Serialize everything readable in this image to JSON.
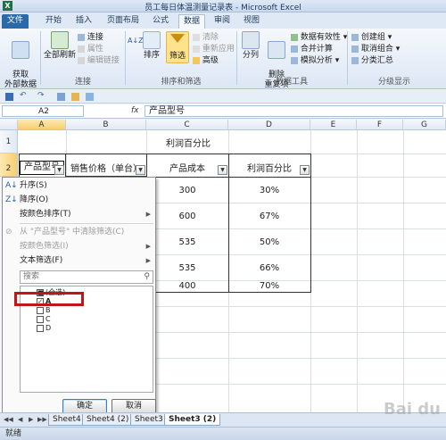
{
  "window": {
    "title": "员工每日体温测量记录表 - Microsoft Excel",
    "app_icon": "X"
  },
  "ribbon_tabs": [
    "文件",
    "开始",
    "插入",
    "页面布局",
    "公式",
    "数据",
    "审阅",
    "视图"
  ],
  "ribbon": {
    "get_external": "获取\n外部数据",
    "refresh_all": "全部刷新",
    "connections": "连接",
    "properties": "属性",
    "edit_links": "编辑链接",
    "sort_asc": "A↓Z",
    "sort": "排序",
    "filter": "筛选",
    "clear": "清除",
    "reapply": "重新应用",
    "advanced": "高级",
    "text_to_columns": "分列",
    "remove_dupes": "删除\n重复项",
    "data_validation": "数据有效性",
    "consolidate": "合并计算",
    "what_if": "模拟分析",
    "group": "创建组",
    "ungroup": "取消组合",
    "subtotal": "分类汇总",
    "group_connections": "连接",
    "group_sort_filter": "排序和筛选",
    "group_data_tools": "数据工具",
    "group_outline": "分级显示"
  },
  "formula_bar": {
    "name_box": "A2",
    "fx": "fx",
    "content": "产品型号"
  },
  "columns": [
    "A",
    "B",
    "C",
    "D",
    "E",
    "F",
    "G"
  ],
  "rows": [
    "1",
    "2"
  ],
  "sheet": {
    "title": "利润百分比",
    "headers": [
      "产品型号",
      "销售价格（单台）",
      "产品成本",
      "利润百分比"
    ],
    "cost": [
      "300",
      "600",
      "535",
      "535",
      "400"
    ],
    "profit": [
      "30%",
      "67%",
      "50%",
      "66%",
      "70%"
    ]
  },
  "dropdown_menu": {
    "sort_asc": "升序(S)",
    "sort_desc": "降序(O)",
    "sort_by_color": "按颜色排序(T)",
    "clear_filter": "从 \"产品型号\" 中清除筛选(C)",
    "filter_by_color": "按颜色筛选(I)",
    "text_filter": "文本筛选(F)",
    "search_placeholder": "搜索",
    "list": [
      "(全选)",
      "A",
      "B",
      "C",
      "D"
    ],
    "ok": "确定",
    "cancel": "取消"
  },
  "sheet_tabs": [
    "Sheet4",
    "Sheet4 (2)",
    "Sheet3",
    "Sheet3 (2)"
  ],
  "active_sheet": "Sheet3 (2)",
  "status": "就绪",
  "watermark": "Bai du"
}
